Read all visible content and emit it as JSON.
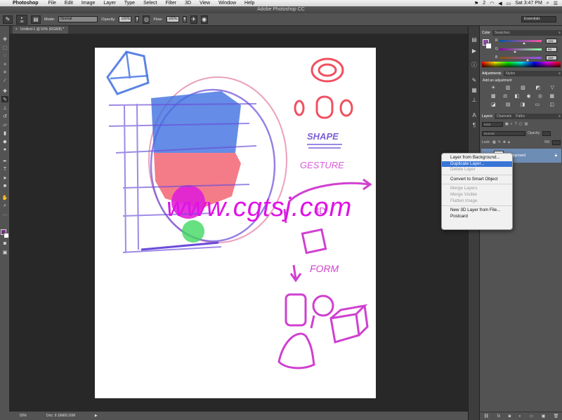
{
  "menubar": {
    "app_name": "Photoshop",
    "items": [
      "File",
      "Edit",
      "Image",
      "Layer",
      "Type",
      "Select",
      "Filter",
      "3D",
      "View",
      "Window",
      "Help"
    ],
    "clock": "Sat 3:47 PM",
    "badge": "2"
  },
  "window": {
    "title": "Adobe Photoshop CC"
  },
  "options": {
    "brush_size": "30",
    "mode_label": "Mode:",
    "mode_value": "Normal",
    "opacity_label": "Opacity:",
    "opacity_value": "100%",
    "flow_label": "Flow:",
    "flow_value": "100%",
    "workspace": "Essentials"
  },
  "document": {
    "tab_title": "Untitled-1 @ 50% (RGB/8) *",
    "watermark": "www.cgtsj.com"
  },
  "status": {
    "zoom": "50%",
    "doc_info": "Doc: 9.16M/9.16M"
  },
  "color_panel": {
    "tabs": [
      "Color",
      "Swatches"
    ],
    "r": "141",
    "g": "84",
    "b": "162",
    "r_label": "R",
    "g_label": "G",
    "b_label": "B",
    "fg_color": "#8d54a2"
  },
  "adjustments_panel": {
    "tabs": [
      "Adjustments",
      "Styles"
    ],
    "title": "Add an adjustment"
  },
  "layers_panel": {
    "tabs": [
      "Layers",
      "Channels",
      "Paths"
    ],
    "kind": "Kind",
    "blend": "Normal",
    "opacity_label": "Opacity:",
    "lock_label": "Lock:",
    "fill_label": "Fill:",
    "layer_name": "Background"
  },
  "context_menu": {
    "items": [
      {
        "label": "Layer from Background...",
        "state": "normal"
      },
      {
        "label": "Duplicate Layer...",
        "state": "highlight"
      },
      {
        "label": "Delete Layer",
        "state": "disabled"
      },
      {
        "label": "Convert to Smart Object",
        "state": "normal"
      },
      {
        "label": "Merge Layers",
        "state": "disabled"
      },
      {
        "label": "Merge Visible",
        "state": "disabled"
      },
      {
        "label": "Flatten Image",
        "state": "disabled"
      },
      {
        "label": "New 3D Layer from File...",
        "state": "normal"
      },
      {
        "label": "Postcard",
        "state": "normal"
      }
    ]
  },
  "canvas_text": {
    "shape": "SHAPE",
    "gesture": "GESTURE",
    "three_d": "3D",
    "form": "FORM"
  }
}
